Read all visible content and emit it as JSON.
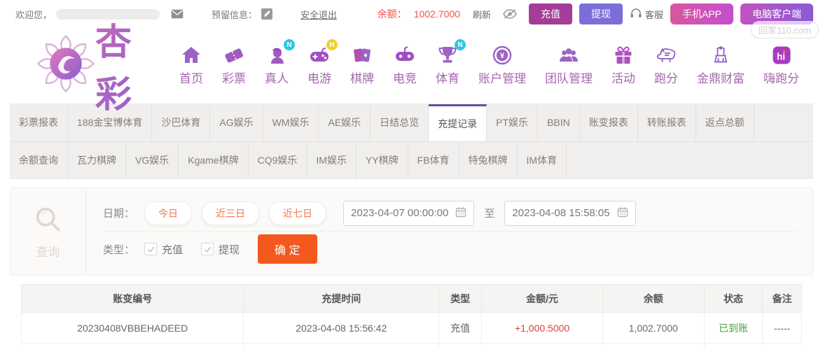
{
  "topbar": {
    "welcome": "欢迎您，",
    "reserved_label": "预留信息：",
    "logout": "安全退出",
    "balance_label": "余额：",
    "balance_value": "1002.7000",
    "refresh": "刷新",
    "recharge_btn": "充值",
    "withdraw_btn": "提现",
    "service": "客服",
    "mobile_app_btn": "手机APP",
    "pc_client_btn": "电脑客户端",
    "watermark": "回家110.com"
  },
  "brand": {
    "logo_text": "杏彩"
  },
  "nav": {
    "items": [
      {
        "key": "home",
        "label": "首页",
        "icon": "home-icon",
        "badge": ""
      },
      {
        "key": "lottery",
        "label": "彩票",
        "icon": "ticket-icon",
        "badge": ""
      },
      {
        "key": "live",
        "label": "真人",
        "icon": "live-person-icon",
        "badge": "N",
        "badge_color": "cyan"
      },
      {
        "key": "egame",
        "label": "电游",
        "icon": "gamepad-icon",
        "badge": "H",
        "badge_color": "yellow"
      },
      {
        "key": "chess",
        "label": "棋牌",
        "icon": "cards-icon",
        "badge": ""
      },
      {
        "key": "esports",
        "label": "电竞",
        "icon": "joystick-icon",
        "badge": ""
      },
      {
        "key": "sports",
        "label": "体育",
        "icon": "trophy-icon",
        "badge": "N",
        "badge_color": "cyan"
      },
      {
        "key": "account",
        "label": "账户管理",
        "icon": "yen-circle-icon",
        "badge": ""
      },
      {
        "key": "team",
        "label": "团队管理",
        "icon": "team-icon",
        "badge": ""
      },
      {
        "key": "activity",
        "label": "活动",
        "icon": "gift-icon",
        "badge": ""
      },
      {
        "key": "paofen",
        "label": "跑分",
        "icon": "rhino-icon",
        "badge": ""
      },
      {
        "key": "jinding",
        "label": "金鼎财富",
        "icon": "throne-icon",
        "badge": ""
      },
      {
        "key": "hipaofen",
        "label": "嗨跑分",
        "icon": "hi-app-icon",
        "badge": ""
      }
    ]
  },
  "tabs": {
    "active": "充提记录",
    "row1": [
      "彩票报表",
      "188金宝博体育",
      "沙巴体育",
      "AG娱乐",
      "WM娱乐",
      "AE娱乐",
      "日结总览",
      "充提记录",
      "PT娱乐",
      "BBIN",
      "账变报表",
      "转账报表",
      "返点总额"
    ],
    "row2": [
      "余额查询",
      "瓦力棋牌",
      "VG娱乐",
      "Kgame棋牌",
      "CQ9娱乐",
      "IM娱乐",
      "YY棋牌",
      "FB体育",
      "特兔棋牌",
      "IM体育"
    ]
  },
  "query": {
    "panel_label": "查询",
    "date_label": "日期：",
    "quick_ranges": [
      "今日",
      "近三日",
      "近七日"
    ],
    "date_from": "2023-04-07 00:00:00",
    "to_label": "至",
    "date_to": "2023-04-08 15:58:05",
    "type_label": "类型：",
    "type_options": [
      {
        "label": "充值",
        "checked": true
      },
      {
        "label": "提现",
        "checked": true
      }
    ],
    "submit_btn": "确 定"
  },
  "table": {
    "headers": [
      "账变编号",
      "充提时间",
      "类型",
      "金额/元",
      "余额",
      "状态",
      "备注"
    ],
    "rows": [
      {
        "cells": [
          "20230408VBBEHADEED",
          "2023-04-08 15:56:42",
          "充值",
          "+1,000.5000",
          "1,002.7000",
          "已到账",
          "-----"
        ]
      }
    ]
  },
  "colors": {
    "accent_purple": "#6b4c9f",
    "nav_purple": "#a566ae",
    "button_orange": "#f3581d",
    "amount_red": "#e03e3e",
    "status_green": "#43a047",
    "balance_red": "#f0544c"
  }
}
